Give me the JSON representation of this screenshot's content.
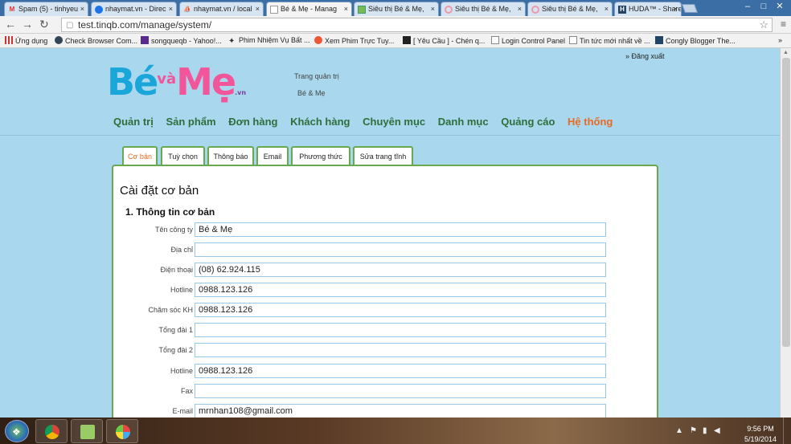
{
  "browser": {
    "tabs": [
      {
        "title": "Spam (5) - tinhyeu",
        "icon": "gmail-icon",
        "active": false
      },
      {
        "title": "nhaymat.vn - Direc",
        "icon": "chrome-icon",
        "active": false
      },
      {
        "title": "nhaymat.vn / local",
        "icon": "phpmyadmin-icon",
        "active": false
      },
      {
        "title": "Bé & Mẹ - Manag",
        "icon": "page-icon",
        "active": true
      },
      {
        "title": "Siêu thị Bé & Mẹ,",
        "icon": "site-icon",
        "active": false
      },
      {
        "title": "Siêu thị Bé & Mẹ,",
        "icon": "loading-icon",
        "active": false
      },
      {
        "title": "Siêu thị Bé & Mẹ,",
        "icon": "loading-icon",
        "active": false
      },
      {
        "title": "HUDA™ - Share fu",
        "icon": "huda-icon",
        "active": false
      }
    ],
    "url": "test.tinqb.com/manage/system/",
    "bookmarks": [
      {
        "label": "Ứng dụng",
        "icon": "apps-icon"
      },
      {
        "label": "Check Browser Com...",
        "icon": "shield-icon"
      },
      {
        "label": "songqueqb - Yahoo!...",
        "icon": "yahoo-icon"
      },
      {
        "label": "Phim Nhiệm Vụ Bất ...",
        "icon": "star-icon"
      },
      {
        "label": "Xem Phim Trực Tuy...",
        "icon": "play-icon"
      },
      {
        "label": "[ Yêu Cầu ] - Chén q...",
        "icon": "forum-icon"
      },
      {
        "label": "Login Control Panel",
        "icon": "page-icon"
      },
      {
        "label": "Tin tức mới nhất về ...",
        "icon": "page-icon"
      },
      {
        "label": "Congly Blogger The...",
        "icon": "blogger-icon"
      }
    ],
    "more_bookmarks": "»"
  },
  "header": {
    "logout": "» Đăng xuất",
    "logo": {
      "be": "Bé",
      "va": "và",
      "me": "Mẹ",
      "vn": ".vn"
    },
    "admin_title": "Trang quản trị",
    "admin_sub": "Bé & Mẹ"
  },
  "nav": {
    "items": [
      "Quản trị",
      "Sản phẩm",
      "Đơn hàng",
      "Khách hàng",
      "Chuyên mục",
      "Danh mục",
      "Quảng cáo",
      "Hệ thống"
    ],
    "active": "Hệ thống"
  },
  "subtabs": {
    "items": [
      "Cơ bản",
      "Tuỳ chọn",
      "Thông báo",
      "Email",
      "Phương thức",
      "Sửa trang tĩnh"
    ],
    "active": "Cơ bản"
  },
  "form": {
    "title": "Cài đặt cơ bản",
    "section": "1. Thông tin cơ bản",
    "fields": [
      {
        "label": "Tên công ty",
        "value": "Bé & Mẹ"
      },
      {
        "label": "Địa chỉ",
        "value": ""
      },
      {
        "label": "Điện thoại",
        "value": "(08) 62.924.115"
      },
      {
        "label": "Hotline",
        "value": "0988.123.126"
      },
      {
        "label": "Chăm sóc KH",
        "value": "0988.123.126"
      },
      {
        "label": "Tổng đài 1",
        "value": ""
      },
      {
        "label": "Tổng đài 2",
        "value": ""
      },
      {
        "label": "Hotline",
        "value": "0988.123.126"
      },
      {
        "label": "Fax",
        "value": ""
      },
      {
        "label": "E-mail",
        "value": "mrnhan108@gmail.com"
      }
    ]
  },
  "taskbar": {
    "time": "9:56 PM",
    "date": "5/19/2014"
  }
}
